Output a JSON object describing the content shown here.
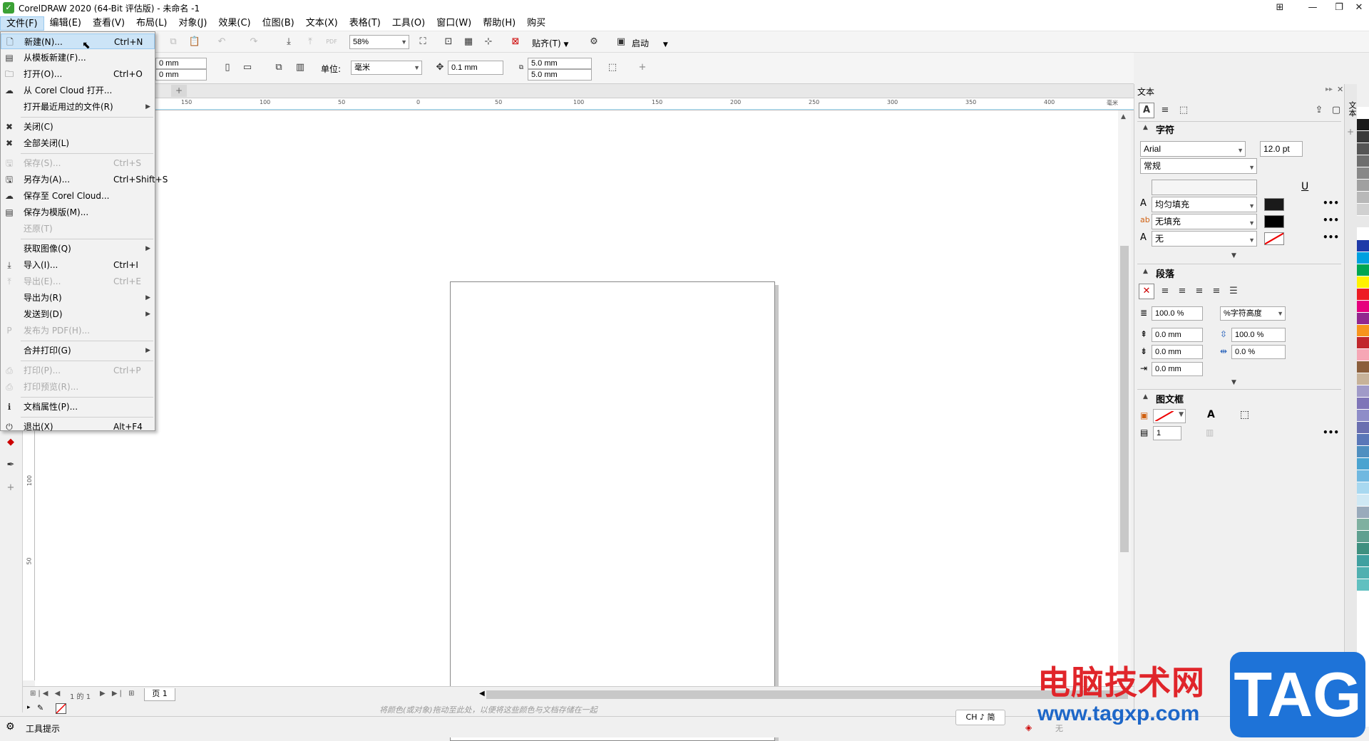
{
  "window": {
    "title": "CorelDRAW 2020 (64-Bit 评估版) - 未命名 -1"
  },
  "menubar": [
    "文件(F)",
    "编辑(E)",
    "查看(V)",
    "布局(L)",
    "对象(J)",
    "效果(C)",
    "位图(B)",
    "文本(X)",
    "表格(T)",
    "工具(O)",
    "窗口(W)",
    "帮助(H)",
    "购买"
  ],
  "toolbar1": {
    "zoom": "58%",
    "snap_label": "贴齐(T)",
    "launch_label": "启动"
  },
  "toolbar2": {
    "width": "0 mm",
    "height": "0 mm",
    "unit_label": "单位:",
    "unit_value": "毫米",
    "nudge": "0.1 mm",
    "dup_x": "5.0 mm",
    "dup_y": "5.0 mm"
  },
  "ruler": {
    "top_ticks": [
      "150",
      "100",
      "50",
      "0",
      "50",
      "100",
      "150",
      "200",
      "250",
      "300",
      "350",
      "400"
    ],
    "unit": "毫米",
    "left_ticks": [
      "100",
      "50"
    ]
  },
  "file_menu": [
    {
      "label": "新建(N)...",
      "shortcut": "Ctrl+N",
      "icon": "new-doc-icon",
      "highlighted": true
    },
    {
      "label": "从模板新建(F)...",
      "shortcut": "",
      "icon": "template-icon"
    },
    {
      "label": "打开(O)...",
      "shortcut": "Ctrl+O",
      "icon": "open-folder-icon"
    },
    {
      "label": "从 Corel Cloud 打开...",
      "shortcut": "",
      "icon": "cloud-open-icon"
    },
    {
      "label": "打开最近用过的文件(R)",
      "shortcut": "",
      "icon": "",
      "submenu": true
    },
    {
      "separator": true
    },
    {
      "label": "关闭(C)",
      "shortcut": "",
      "icon": "close-doc-icon"
    },
    {
      "label": "全部关闭(L)",
      "shortcut": "",
      "icon": "close-all-icon"
    },
    {
      "separator": true
    },
    {
      "label": "保存(S)...",
      "shortcut": "Ctrl+S",
      "icon": "save-icon",
      "disabled": true
    },
    {
      "label": "另存为(A)...",
      "shortcut": "Ctrl+Shift+S",
      "icon": "save-as-icon"
    },
    {
      "label": "保存至 Corel Cloud...",
      "shortcut": "",
      "icon": "cloud-save-icon"
    },
    {
      "label": "保存为模版(M)...",
      "shortcut": "",
      "icon": "save-template-icon"
    },
    {
      "label": "还原(T)",
      "shortcut": "",
      "icon": "",
      "disabled": true
    },
    {
      "separator": true
    },
    {
      "label": "获取图像(Q)",
      "shortcut": "",
      "icon": "",
      "submenu": true
    },
    {
      "label": "导入(I)...",
      "shortcut": "Ctrl+I",
      "icon": "import-icon"
    },
    {
      "label": "导出(E)...",
      "shortcut": "Ctrl+E",
      "icon": "export-icon",
      "disabled": true
    },
    {
      "label": "导出为(R)",
      "shortcut": "",
      "icon": "",
      "submenu": true
    },
    {
      "label": "发送到(D)",
      "shortcut": "",
      "icon": "",
      "submenu": true
    },
    {
      "label": "发布为 PDF(H)...",
      "shortcut": "",
      "icon": "pdf-icon",
      "disabled": true
    },
    {
      "separator": true
    },
    {
      "label": "合并打印(G)",
      "shortcut": "",
      "icon": "",
      "submenu": true
    },
    {
      "separator": true
    },
    {
      "label": "打印(P)...",
      "shortcut": "Ctrl+P",
      "icon": "print-icon",
      "disabled": true
    },
    {
      "label": "打印预览(R)...",
      "shortcut": "",
      "icon": "print-preview-icon",
      "disabled": true
    },
    {
      "separator": true
    },
    {
      "label": "文档属性(P)...",
      "shortcut": "",
      "icon": "doc-properties-icon"
    },
    {
      "separator": true
    },
    {
      "label": "退出(X)",
      "shortcut": "Alt+F4",
      "icon": "exit-icon"
    }
  ],
  "document": {
    "page_tab": "页 1",
    "page_counter": "1 的 1"
  },
  "status": {
    "tool_hint": "工具提示",
    "drag_hint": "将颜色(或对象)拖动至此处，以便将这些颜色与文档存储在一起",
    "ime": "CH ♪ 简",
    "fill_none": "无"
  },
  "dock": {
    "title": "文本",
    "char_section": "字符",
    "font": "Arial",
    "font_size": "12.0 pt",
    "font_style": "常规",
    "fill_type": "均匀填充",
    "bg_fill": "无填充",
    "outline": "无",
    "para_section": "段落",
    "line_spacing": "100.0 %",
    "line_spacing_unit": "%字符高度",
    "before_para": "0.0 mm",
    "char_spacing": "100.0 %",
    "after_para": "0.0 mm",
    "word_spacing": "0.0 %",
    "indent": "0.0 mm",
    "frame_section": "图文框",
    "columns": "1"
  },
  "side_tab": "文本",
  "palette_colors": [
    "#ffffff",
    "#1a1a1a",
    "#3a3a3a",
    "#555555",
    "#6e6e6e",
    "#888888",
    "#a0a0a0",
    "#b8b8b8",
    "#d0d0d0",
    "#e8e8e8",
    "#ffffff",
    "#1e3aa8",
    "#00a0e0",
    "#00a651",
    "#fff200",
    "#ed1c24",
    "#e6007e",
    "#92278f",
    "#f7941d",
    "#c1272d",
    "#f6a6b5",
    "#8b5e3c",
    "#c7b299",
    "#a09ac8",
    "#7f75b8",
    "#8e8dc8",
    "#6a6fb0",
    "#5a77b8",
    "#4f8fc0",
    "#4aa3d0",
    "#70b8e0",
    "#a8d8f0",
    "#cfe8f4",
    "#9ab",
    "#7fb0a0",
    "#5fa090",
    "#3f9080",
    "#40a0a0",
    "#50b0b0",
    "#60c0c0"
  ],
  "watermark": {
    "site_name": "电脑技术网",
    "url": "www.tagxp.com",
    "badge": "TAG"
  }
}
